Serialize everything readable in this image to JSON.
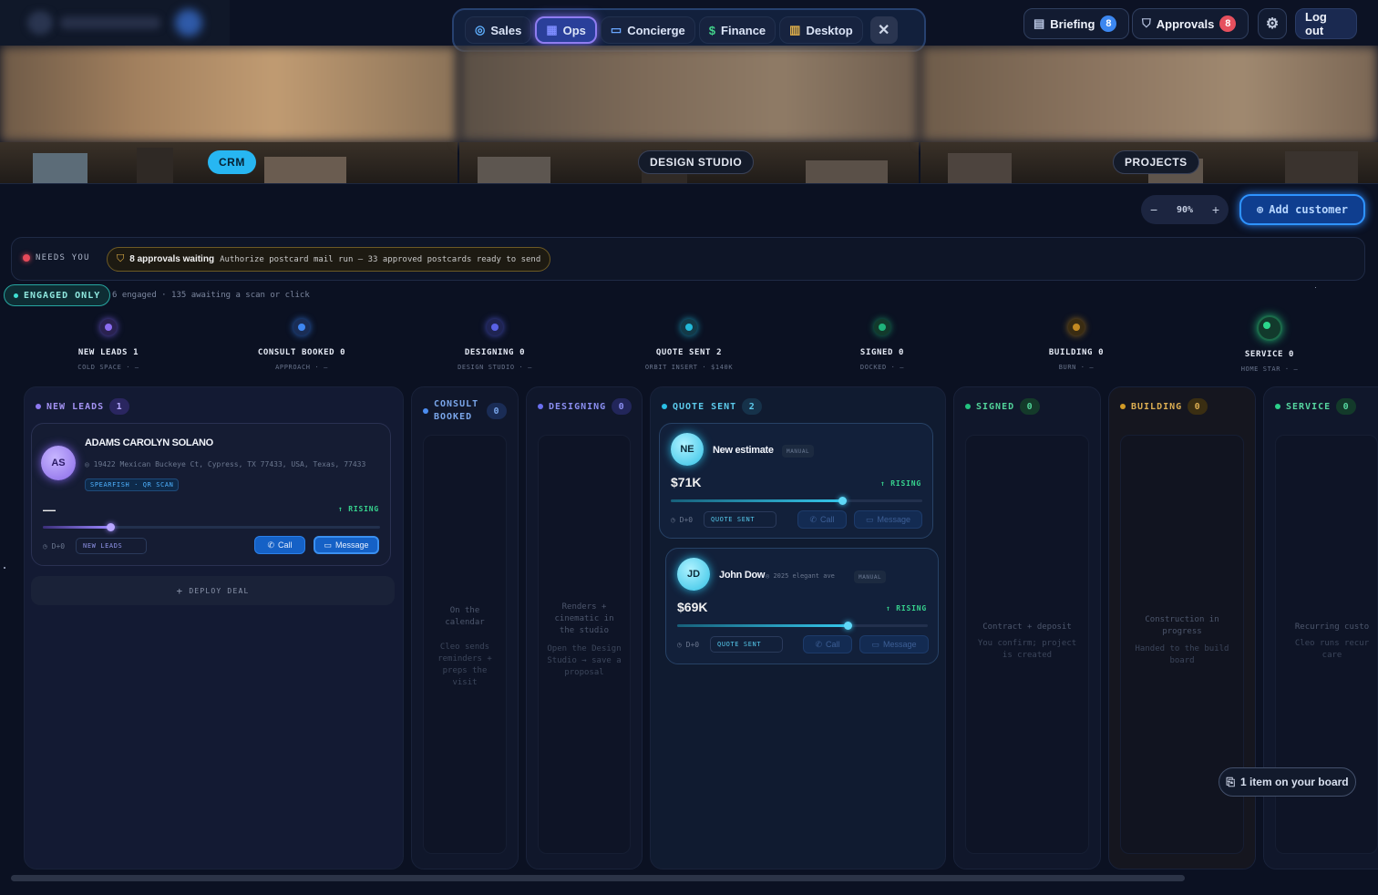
{
  "nav": {
    "tabs": [
      {
        "label": "Sales",
        "icon": "target-icon",
        "active": false
      },
      {
        "label": "Ops",
        "icon": "grid-icon",
        "active": true
      },
      {
        "label": "Concierge",
        "icon": "chat-icon",
        "active": false
      },
      {
        "label": "Finance",
        "icon": "dollar-icon",
        "active": false
      },
      {
        "label": "Desktop",
        "icon": "building-icon",
        "active": false
      }
    ],
    "close_icon": "close-icon"
  },
  "topbar": {
    "briefing": {
      "label": "Briefing",
      "count": "8"
    },
    "approvals": {
      "label": "Approvals",
      "count": "8"
    },
    "logout": "Log out"
  },
  "hero": {
    "sections": [
      {
        "label": "CRM",
        "active": true
      },
      {
        "label": "DESIGN STUDIO",
        "active": false
      },
      {
        "label": "PROJECTS",
        "active": false
      }
    ]
  },
  "controls": {
    "zoom": "90%",
    "zoom_minus": "−",
    "zoom_plus": "+",
    "add_customer": "Add customer"
  },
  "needs": {
    "label": "NEEDS YOU",
    "approvals_title": "8 approvals waiting",
    "approvals_text": "Authorize postcard mail run — 33 approved postcards ready to send"
  },
  "engaged": {
    "button": "ENGAGED ONLY",
    "info": "6 engaged · 135 awaiting a scan or click"
  },
  "stages": [
    {
      "name": "NEW LEADS 1",
      "sub": "COLD SPACE · —",
      "color": "#8b6cf0"
    },
    {
      "name": "CONSULT BOOKED 0",
      "sub": "APPROACH · —",
      "color": "#3e86f0"
    },
    {
      "name": "DESIGNING 0",
      "sub": "DESIGN STUDIO · —",
      "color": "#5a62e6"
    },
    {
      "name": "QUOTE SENT 2",
      "sub": "ORBIT INSERT · $140K",
      "color": "#22b9d9"
    },
    {
      "name": "SIGNED 0",
      "sub": "DOCKED · —",
      "color": "#1fb27a"
    },
    {
      "name": "BUILDING 0",
      "sub": "BURN · —",
      "color": "#c48a22"
    },
    {
      "name": "SERVICE 0",
      "sub": "HOME STAR · —",
      "color": "#2bd88c"
    }
  ],
  "columns": [
    {
      "title": "NEW LEADS",
      "count": "1",
      "color": "#8d78f2"
    },
    {
      "title": "CONSULT BOOKED",
      "count": "0",
      "color": "#4c8df0",
      "desc": "On the calendar",
      "desc2": "Cleo sends reminders + preps the visit"
    },
    {
      "title": "DESIGNING",
      "count": "0",
      "color": "#6a6ff0",
      "desc": "Renders + cinematic in the studio",
      "desc2": "Open the Design Studio → save a proposal"
    },
    {
      "title": "QUOTE SENT",
      "count": "2",
      "color": "#2ac0e6"
    },
    {
      "title": "SIGNED",
      "count": "0",
      "color": "#22c27f",
      "desc": "Contract + deposit",
      "desc2": "You confirm; project is created"
    },
    {
      "title": "BUILDING",
      "count": "0",
      "color": "#d19a26",
      "desc": "Construction in progress",
      "desc2": "Handed to the build board"
    },
    {
      "title": "SERVICE",
      "count": "0",
      "color": "#2ccf8a",
      "desc": "Recurring custo",
      "desc2": "Cleo runs recur care"
    }
  ],
  "cards": {
    "lead": {
      "initials": "AS",
      "name": "ADAMS CAROLYN SOLANO",
      "address": "19422 Mexican Buckeye Ct, Cypress, TX 77433, USA, Texas, 77433",
      "tag": "SPEARFISH · QR SCAN",
      "value": "—",
      "trend": "RISING",
      "progress": 0.2,
      "day": "D+0",
      "stage": "NEW LEADS",
      "call": "Call",
      "message": "Message"
    },
    "quote1": {
      "initials": "NE",
      "name": "New estimate",
      "tag": "MANUAL",
      "value": "$71K",
      "trend": "RISING",
      "progress": 0.68,
      "day": "D+0",
      "stage": "QUOTE SENT",
      "call": "Call",
      "message": "Message"
    },
    "quote2": {
      "initials": "JD",
      "name": "John Dow",
      "address": "2025 elegant ave",
      "tag": "MANUAL",
      "value": "$69K",
      "trend": "RISING",
      "progress": 0.68,
      "day": "D+0",
      "stage": "QUOTE SENT",
      "call": "Call",
      "message": "Message"
    }
  },
  "deploy": "DEPLOY DEAL",
  "board_count": "1 item on your board"
}
